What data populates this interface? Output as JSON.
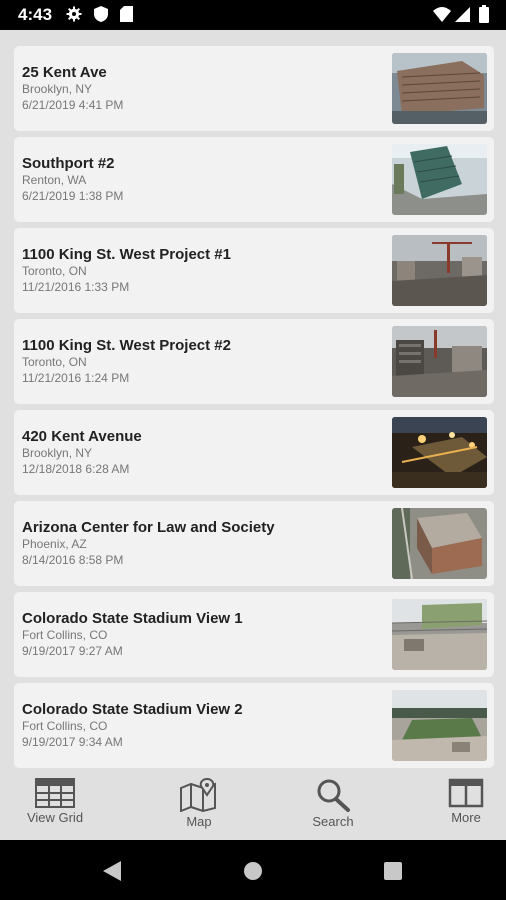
{
  "status_bar": {
    "time": "4:43",
    "left_icons": [
      "gear-icon",
      "shield-icon",
      "sd-card-icon"
    ],
    "right_icons": [
      "wifi-icon",
      "signal-icon",
      "battery-icon"
    ]
  },
  "projects": [
    {
      "title": "25 Kent Ave",
      "location": "Brooklyn, NY",
      "date": "6/21/2019 4:41 PM"
    },
    {
      "title": "Southport #2",
      "location": "Renton, WA",
      "date": "6/21/2019 1:38 PM"
    },
    {
      "title": "1100 King St. West Project #1",
      "location": "Toronto, ON",
      "date": "11/21/2016 1:33 PM"
    },
    {
      "title": "1100 King St. West Project #2",
      "location": "Toronto, ON",
      "date": "11/21/2016 1:24 PM"
    },
    {
      "title": "420 Kent Avenue",
      "location": "Brooklyn, NY",
      "date": "12/18/2018 6:28 AM"
    },
    {
      "title": "Arizona Center for Law and Society",
      "location": "Phoenix, AZ",
      "date": "8/14/2016 8:58 PM"
    },
    {
      "title": "Colorado State Stadium View 1",
      "location": "Fort Collins, CO",
      "date": "9/19/2017 9:27 AM"
    },
    {
      "title": "Colorado State Stadium View 2",
      "location": "Fort Collins, CO",
      "date": "9/19/2017 9:34 AM"
    }
  ],
  "tab_bar": {
    "view_grid": "View Grid",
    "map": "Map",
    "search": "Search",
    "more": "More"
  },
  "nav_bar": {
    "icons": [
      "back-icon",
      "home-icon",
      "recents-icon"
    ]
  },
  "colors": {
    "background": "#e0e0e0",
    "card": "#f2f2f2",
    "title_text": "#222222",
    "secondary_text": "#777777",
    "tab_icon": "#555555"
  }
}
